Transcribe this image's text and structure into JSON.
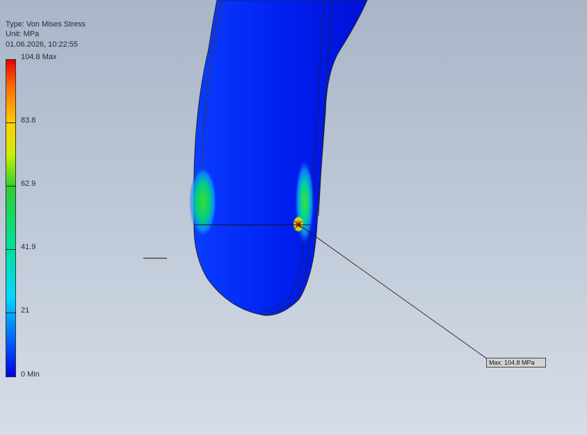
{
  "legend": {
    "type_label": "Type: Von Mises Stress",
    "unit_label": "Unit: MPa",
    "timestamp": "01.06.2026, 10:22:55",
    "ticks": [
      {
        "label": "104.8 Max",
        "value": 104.8
      },
      {
        "label": "83.8",
        "value": 83.8
      },
      {
        "label": "62.9",
        "value": 62.9
      },
      {
        "label": "41.9",
        "value": 41.9
      },
      {
        "label": "21",
        "value": 21
      },
      {
        "label": "0 Min",
        "value": 0
      }
    ],
    "colors": {
      "max": "#e60000",
      "high": "#ffd000",
      "mid": "#2fd02f",
      "low_mid": "#00d8ff",
      "min": "#0000e0"
    }
  },
  "probe": {
    "label": "Max: 104.8 MPa"
  },
  "viewport": {
    "background_top": "#a9b6c8",
    "background_bottom": "#d6dde7"
  }
}
